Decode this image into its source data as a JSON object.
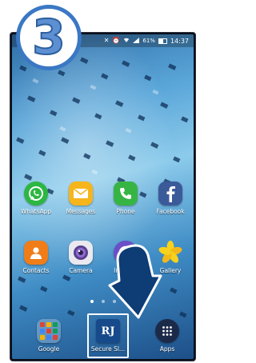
{
  "step": {
    "number": "3"
  },
  "status_bar": {
    "battery": "61%",
    "time": "14:37"
  },
  "home": {
    "row1": [
      {
        "label": "WhatsApp",
        "icon": "whatsapp-icon",
        "color": "#2db742"
      },
      {
        "label": "Messages",
        "icon": "messages-icon",
        "color": "#f5b51b"
      },
      {
        "label": "Phone",
        "icon": "phone-icon",
        "color": "#36b544"
      },
      {
        "label": "Facebook",
        "icon": "facebook-icon",
        "color": "#3b5a9a"
      }
    ],
    "row2": [
      {
        "label": "Contacts",
        "icon": "contacts-icon",
        "color": "#f07d18"
      },
      {
        "label": "Camera",
        "icon": "camera-icon",
        "color": "#e9e9ef"
      },
      {
        "label": "Internet",
        "icon": "internet-icon",
        "color": "#6a4fc8"
      },
      {
        "label": "Gallery",
        "icon": "gallery-icon",
        "color": "#f3c21c"
      }
    ],
    "dock": [
      {
        "label": "Google",
        "icon": "google-folder-icon"
      },
      {
        "label": "Secure Sl...",
        "icon": "rj-logo",
        "logo_text": "RJ",
        "color": "#174a8b"
      },
      {
        "label": "Apps",
        "icon": "apps-grid-icon",
        "color": "#1c2a4a"
      }
    ]
  }
}
